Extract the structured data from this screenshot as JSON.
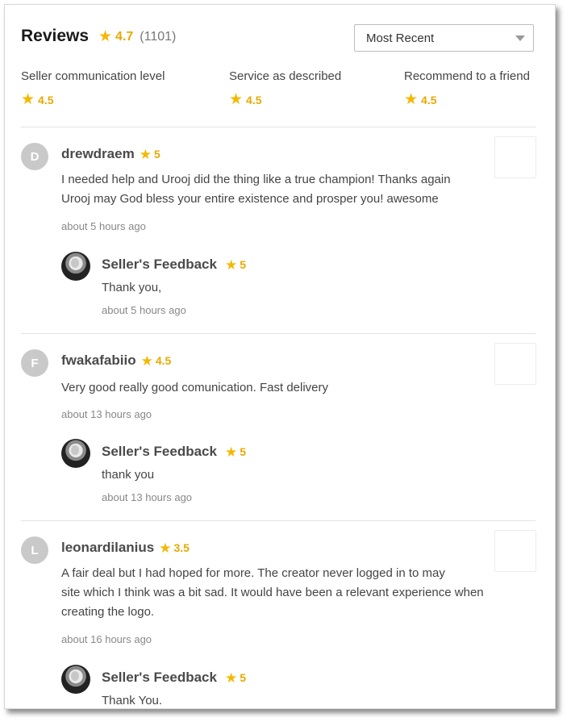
{
  "reviews_header": {
    "title": "Reviews",
    "overall_rating": "4.7",
    "review_count": "(1101)",
    "sort_selected": "Most Recent"
  },
  "metrics": [
    {
      "label": "Seller communication level",
      "value": "4.5"
    },
    {
      "label": "Service as described",
      "value": "4.5"
    },
    {
      "label": "Recommend to a friend",
      "value": "4.5"
    }
  ],
  "reviews": [
    {
      "initial": "D",
      "username": "drewdraem",
      "rating": "5",
      "text_lines": [
        "I needed help and Urooj did the thing like a true champion! Thanks again",
        "Urooj may God bless your entire existence and prosper you! awesome"
      ],
      "time": "about 5 hours ago",
      "feedback": {
        "title": "Seller's Feedback",
        "rating": "5",
        "text": "Thank you,",
        "time": "about 5 hours ago"
      }
    },
    {
      "initial": "F",
      "username": "fwakafabiio",
      "rating": "4.5",
      "text_lines": [
        "Very good really good comunication. Fast delivery"
      ],
      "time": "about 13 hours ago",
      "feedback": {
        "title": "Seller's Feedback",
        "rating": "5",
        "text": "thank you",
        "time": "about 13 hours ago"
      }
    },
    {
      "initial": "L",
      "username": "leonardilanius",
      "rating": "3.5",
      "text_lines": [
        "A fair deal but I had hoped for more. The creator never logged in to may",
        "site which I think was a bit sad. It would have been a relevant experience when",
        "creating the logo."
      ],
      "time": "about 16 hours ago",
      "feedback": {
        "title": "Seller's Feedback",
        "rating": "5",
        "text": "Thank You.",
        "time": ""
      }
    }
  ],
  "colors": {
    "star": "#f5b800",
    "rating_text": "#e8a900"
  },
  "icons": {
    "star": "star-icon",
    "dropdown": "chevron-down-icon"
  }
}
